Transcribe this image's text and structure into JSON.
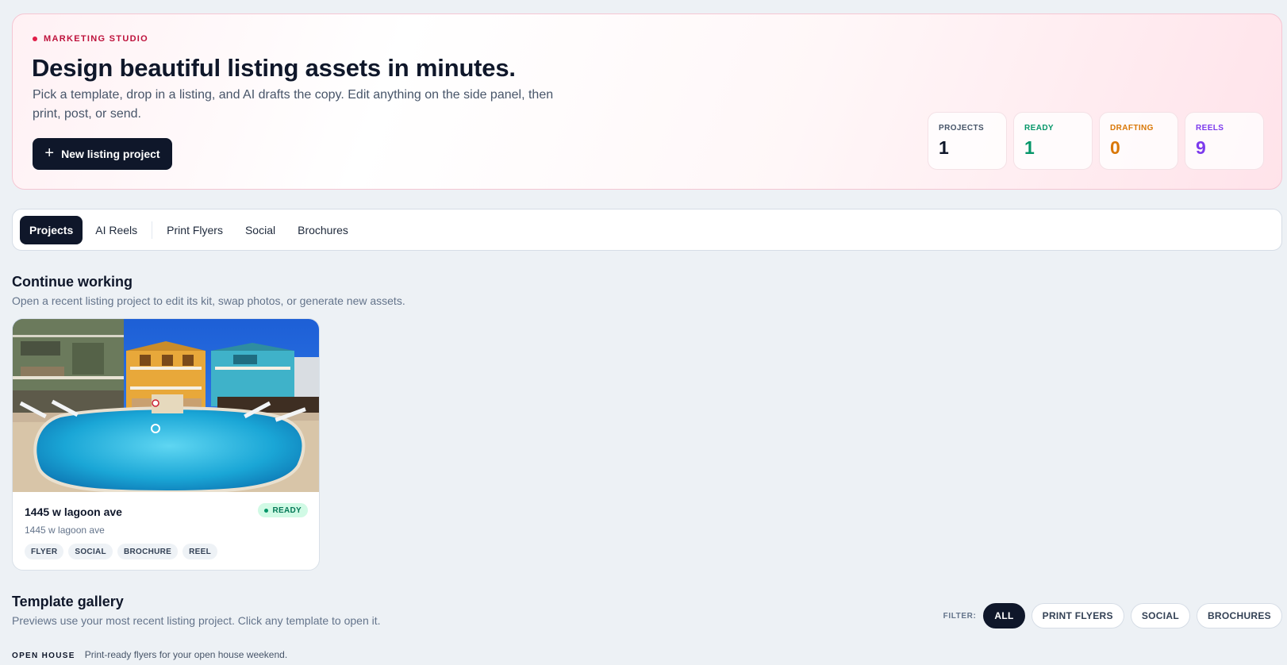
{
  "hero": {
    "eyebrow": "MARKETING STUDIO",
    "title": "Design beautiful listing assets in minutes.",
    "subtitle": "Pick a template, drop in a listing, and AI drafts the copy. Edit anything on the side panel, then print, post, or send.",
    "new_button_label": "New listing project"
  },
  "stats": [
    {
      "label": "PROJECTS",
      "value": "1",
      "color": "#0f172a"
    },
    {
      "label": "READY",
      "value": "1",
      "color": "#059669"
    },
    {
      "label": "DRAFTING",
      "value": "0",
      "color": "#d97706"
    },
    {
      "label": "REELS",
      "value": "9",
      "color": "#7c3aed"
    }
  ],
  "tabs": [
    {
      "label": "Projects",
      "active": true
    },
    {
      "label": "AI Reels"
    },
    {
      "label": "Print Flyers"
    },
    {
      "label": "Social"
    },
    {
      "label": "Brochures"
    }
  ],
  "continue": {
    "title": "Continue working",
    "subtitle": "Open a recent listing project to edit its kit, swap photos, or generate new assets."
  },
  "project_card": {
    "title": "1445 w lagoon ave",
    "address": "1445 w lagoon ave",
    "status": "READY",
    "status_color": "#059669",
    "chips": [
      "FLYER",
      "SOCIAL",
      "BROCHURE",
      "REEL"
    ]
  },
  "gallery": {
    "title": "Template gallery",
    "subtitle": "Previews use your most recent listing project. Click any template to open it.",
    "filter_label": "FILTER:",
    "filters": [
      {
        "label": "ALL",
        "active": true
      },
      {
        "label": "PRINT FLYERS"
      },
      {
        "label": "SOCIAL"
      },
      {
        "label": "BROCHURES"
      }
    ],
    "category_label": "OPEN HOUSE",
    "category_desc": "Print-ready flyers for your open house weekend."
  }
}
